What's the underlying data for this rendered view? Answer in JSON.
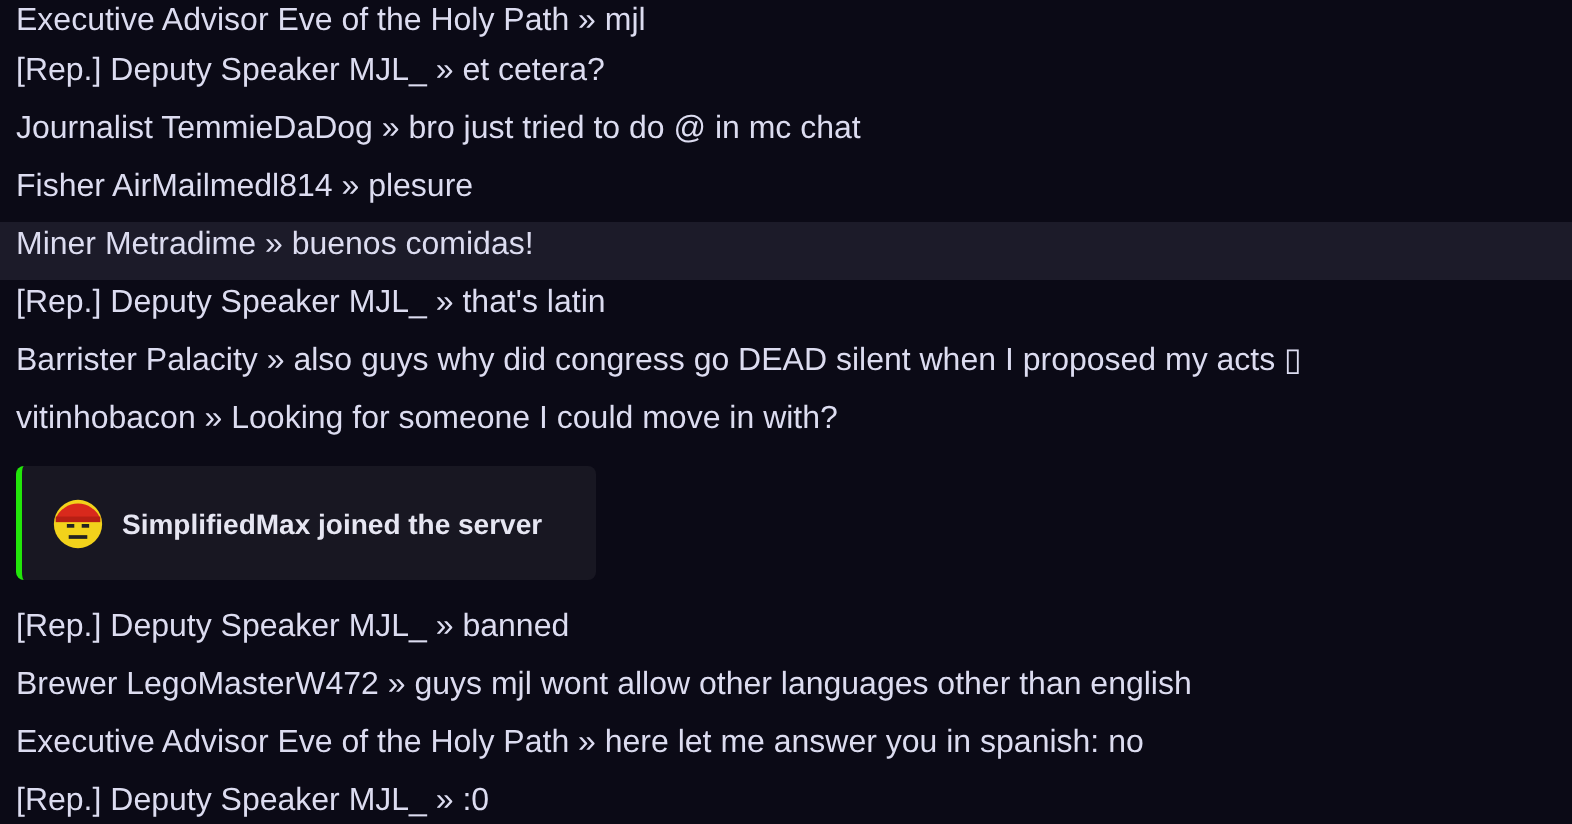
{
  "messages": [
    {
      "kind": "message",
      "text": "Executive Advisor Eve of the Holy Path » mjl",
      "highlighted": false
    },
    {
      "kind": "message",
      "text": "[Rep.] Deputy Speaker MJL_ » et cetera?",
      "highlighted": false
    },
    {
      "kind": "message",
      "text": "Journalist TemmieDaDog » bro just tried to do @ in mc chat",
      "highlighted": false
    },
    {
      "kind": "message",
      "text": "Fisher AirMailmedl814 » plesure",
      "highlighted": false
    },
    {
      "kind": "message",
      "text": "Miner Metradime » buenos comidas!",
      "highlighted": true
    },
    {
      "kind": "message",
      "text": "[Rep.] Deputy Speaker MJL_ » that's latin",
      "highlighted": false
    },
    {
      "kind": "message",
      "text": "Barrister Palacity » also guys why did congress go DEAD silent when I proposed my acts ▯",
      "highlighted": false
    },
    {
      "kind": "message",
      "text": "vitinhobacon » Looking for someone I could move in with?",
      "highlighted": false
    },
    {
      "kind": "join",
      "text": "SimplifiedMax joined the server",
      "color": "#22e60a"
    },
    {
      "kind": "message",
      "text": "[Rep.] Deputy Speaker MJL_ » banned",
      "highlighted": false
    },
    {
      "kind": "message",
      "text": "Brewer LegoMasterW472 » guys mjl wont allow other languages other than english",
      "highlighted": false
    },
    {
      "kind": "message",
      "text": "Executive Advisor Eve of the Holy Path » here let me answer you in spanish: no",
      "highlighted": false
    },
    {
      "kind": "message",
      "text": "[Rep.] Deputy Speaker MJL_ » :0",
      "highlighted": false
    }
  ]
}
